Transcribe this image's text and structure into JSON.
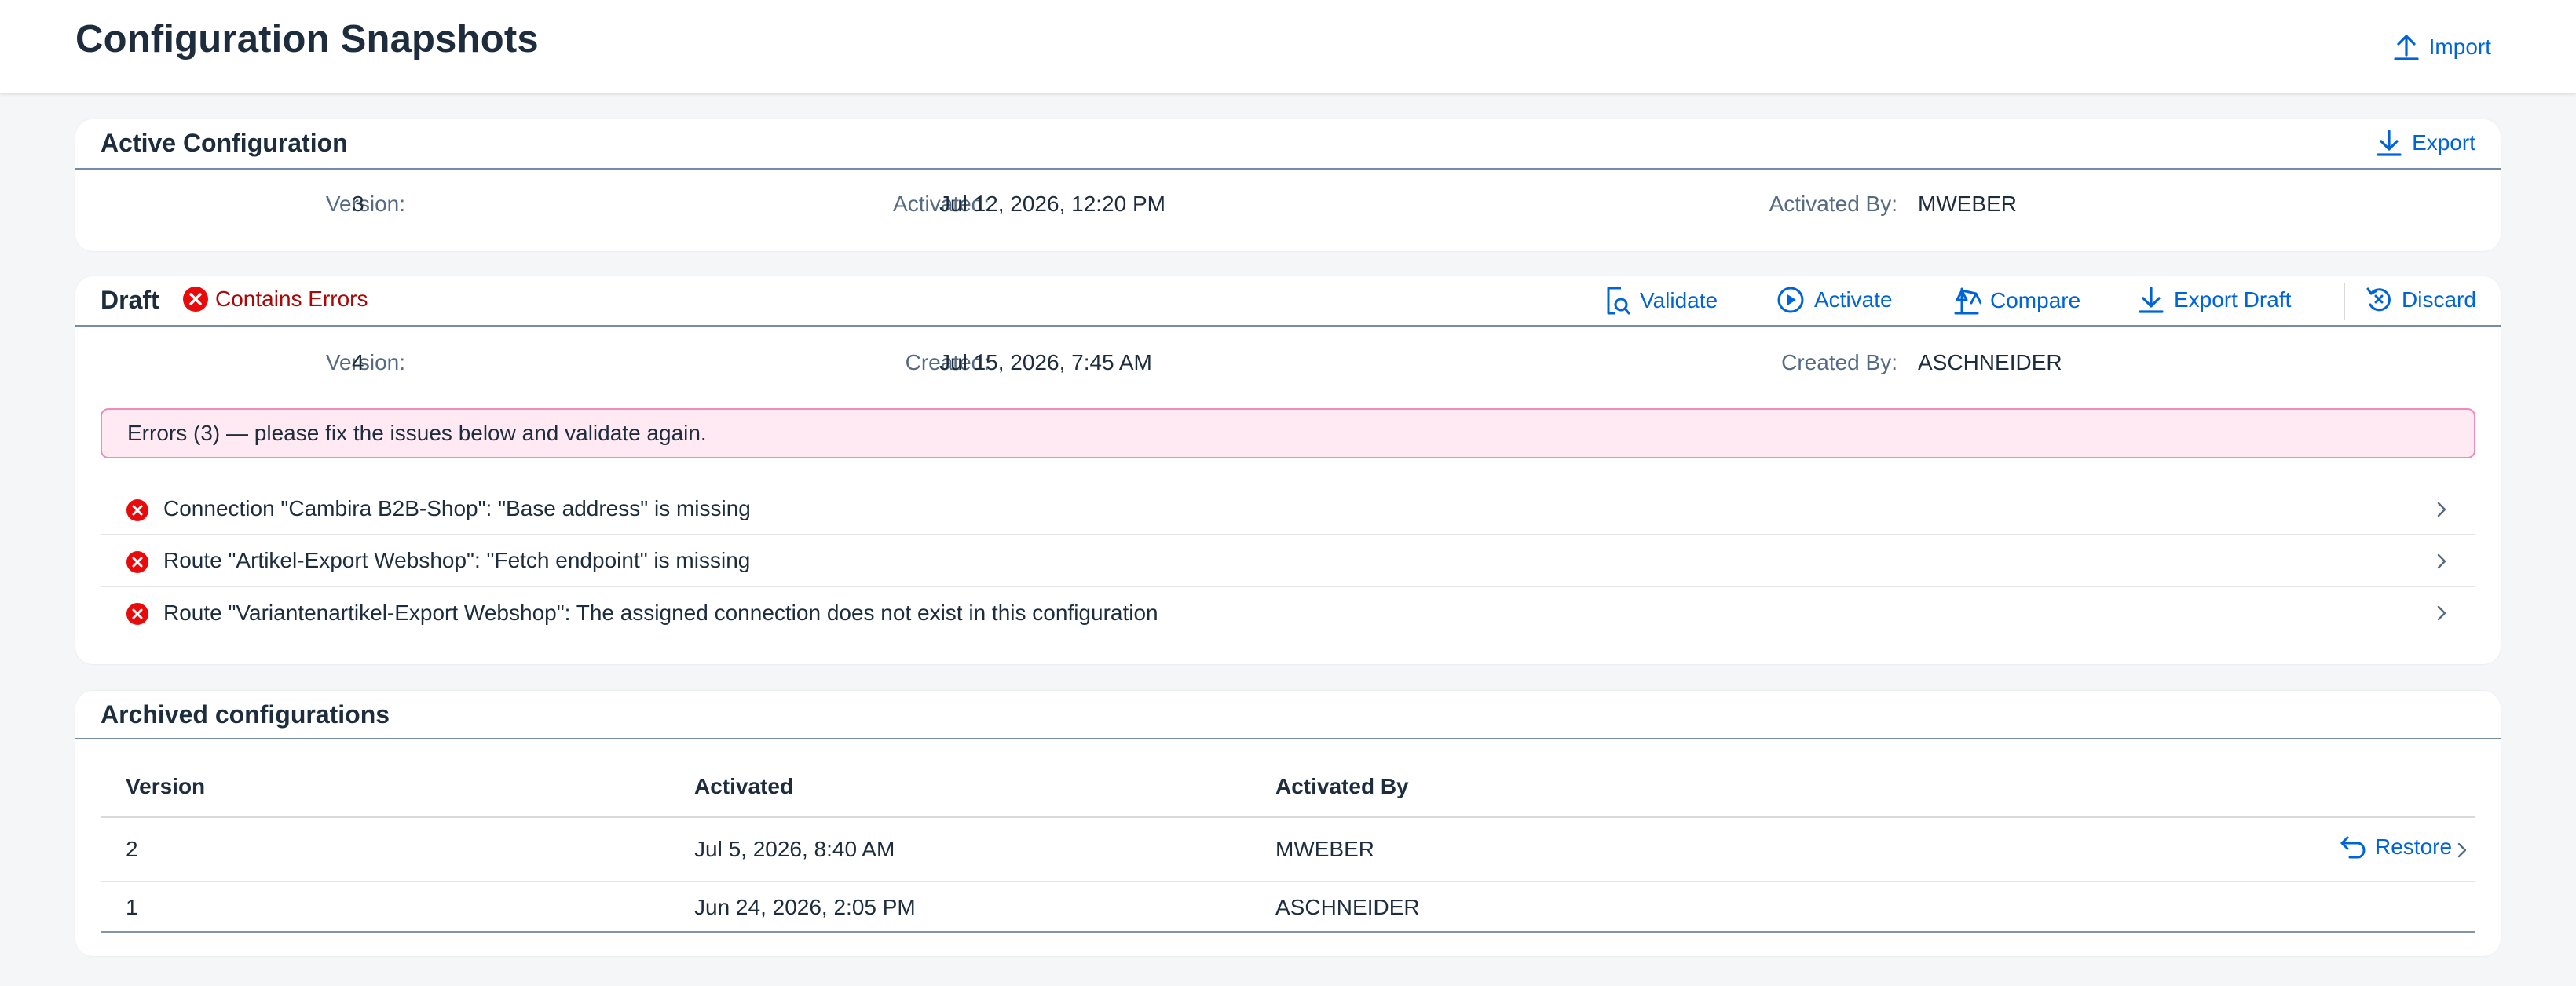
{
  "header": {
    "title": "Configuration Snapshots",
    "import_label": "Import"
  },
  "active": {
    "title": "Active Configuration",
    "export_label": "Export",
    "version_label": "Version:",
    "version_value": "3",
    "activated_label": "Activated:",
    "activated_value": "Jul 12, 2026, 12:20 PM",
    "activated_by_label": "Activated By:",
    "activated_by_value": "MWEBER"
  },
  "draft": {
    "title": "Draft",
    "status_label": "Contains Errors",
    "actions": {
      "validate": "Validate",
      "activate": "Activate",
      "compare": "Compare",
      "export_draft": "Export Draft",
      "discard": "Discard"
    },
    "version_label": "Version:",
    "version_value": "4",
    "created_label": "Created:",
    "created_value": "Jul 15, 2026, 7:45 AM",
    "created_by_label": "Created By:",
    "created_by_value": "ASCHNEIDER",
    "error_summary": "Errors (3) — please fix the issues below and validate again.",
    "errors": [
      "Connection \"Cambira B2B-Shop\": \"Base address\" is missing",
      "Route \"Artikel-Export Webshop\": \"Fetch endpoint\" is missing",
      "Route \"Variantenartikel-Export Webshop\": The assigned connection does not exist in this configuration"
    ]
  },
  "archived": {
    "title": "Archived configurations",
    "columns": {
      "version": "Version",
      "activated": "Activated",
      "activated_by": "Activated By"
    },
    "rows": [
      {
        "version": "2",
        "activated": "Jul 5, 2026, 8:40 AM",
        "activated_by": "MWEBER",
        "action": "Restore"
      },
      {
        "version": "1",
        "activated": "Jun 24, 2026, 2:05 PM",
        "activated_by": "ASCHNEIDER"
      }
    ]
  },
  "colors": {
    "accent": "#0064d9",
    "error": "#e90b0b",
    "error_text": "#aa0808",
    "error_strip_bg": "#ffeaf4"
  },
  "icons": {
    "import": "upload-icon",
    "export": "download-icon",
    "status": "error-icon",
    "validate": "validate-icon",
    "activate": "play-icon",
    "compare": "balance-scale-icon",
    "export_draft": "download-icon",
    "discard": "discard-icon",
    "row_nav": "chevron-right-icon",
    "restore": "undo-icon"
  }
}
